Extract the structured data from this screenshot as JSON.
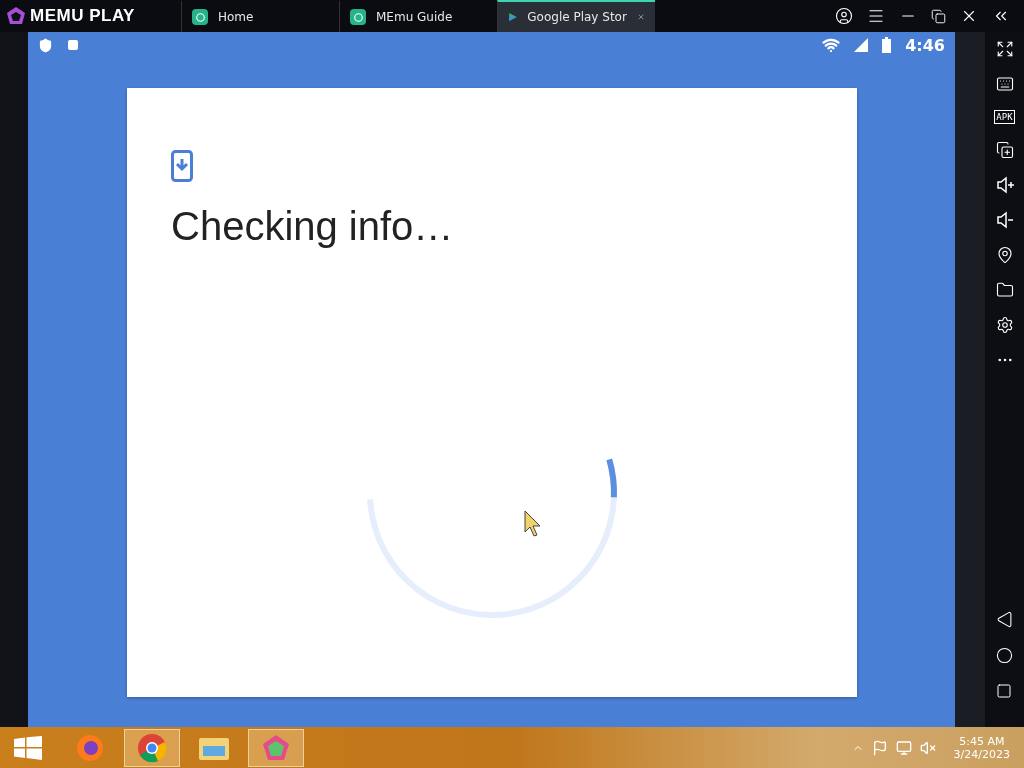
{
  "title_bar": {
    "logo": "MEMU PLAY",
    "tabs": [
      {
        "label": "Home",
        "selected": false
      },
      {
        "label": "MEmu Guide",
        "selected": false
      },
      {
        "label": "Google Play Stor",
        "selected": true
      }
    ]
  },
  "android": {
    "status_bar": {
      "time": "4:46"
    },
    "dialog": {
      "title": "Checking info…"
    }
  },
  "side_toolbar": {
    "apk_label": "APK"
  },
  "taskbar": {
    "apps": [
      {
        "kind": "firefox",
        "selected": false
      },
      {
        "kind": "chrome",
        "selected": true
      },
      {
        "kind": "explorer",
        "selected": false
      },
      {
        "kind": "memu",
        "selected": true
      }
    ],
    "time": "5:45 AM",
    "date": "3/24/2023"
  }
}
